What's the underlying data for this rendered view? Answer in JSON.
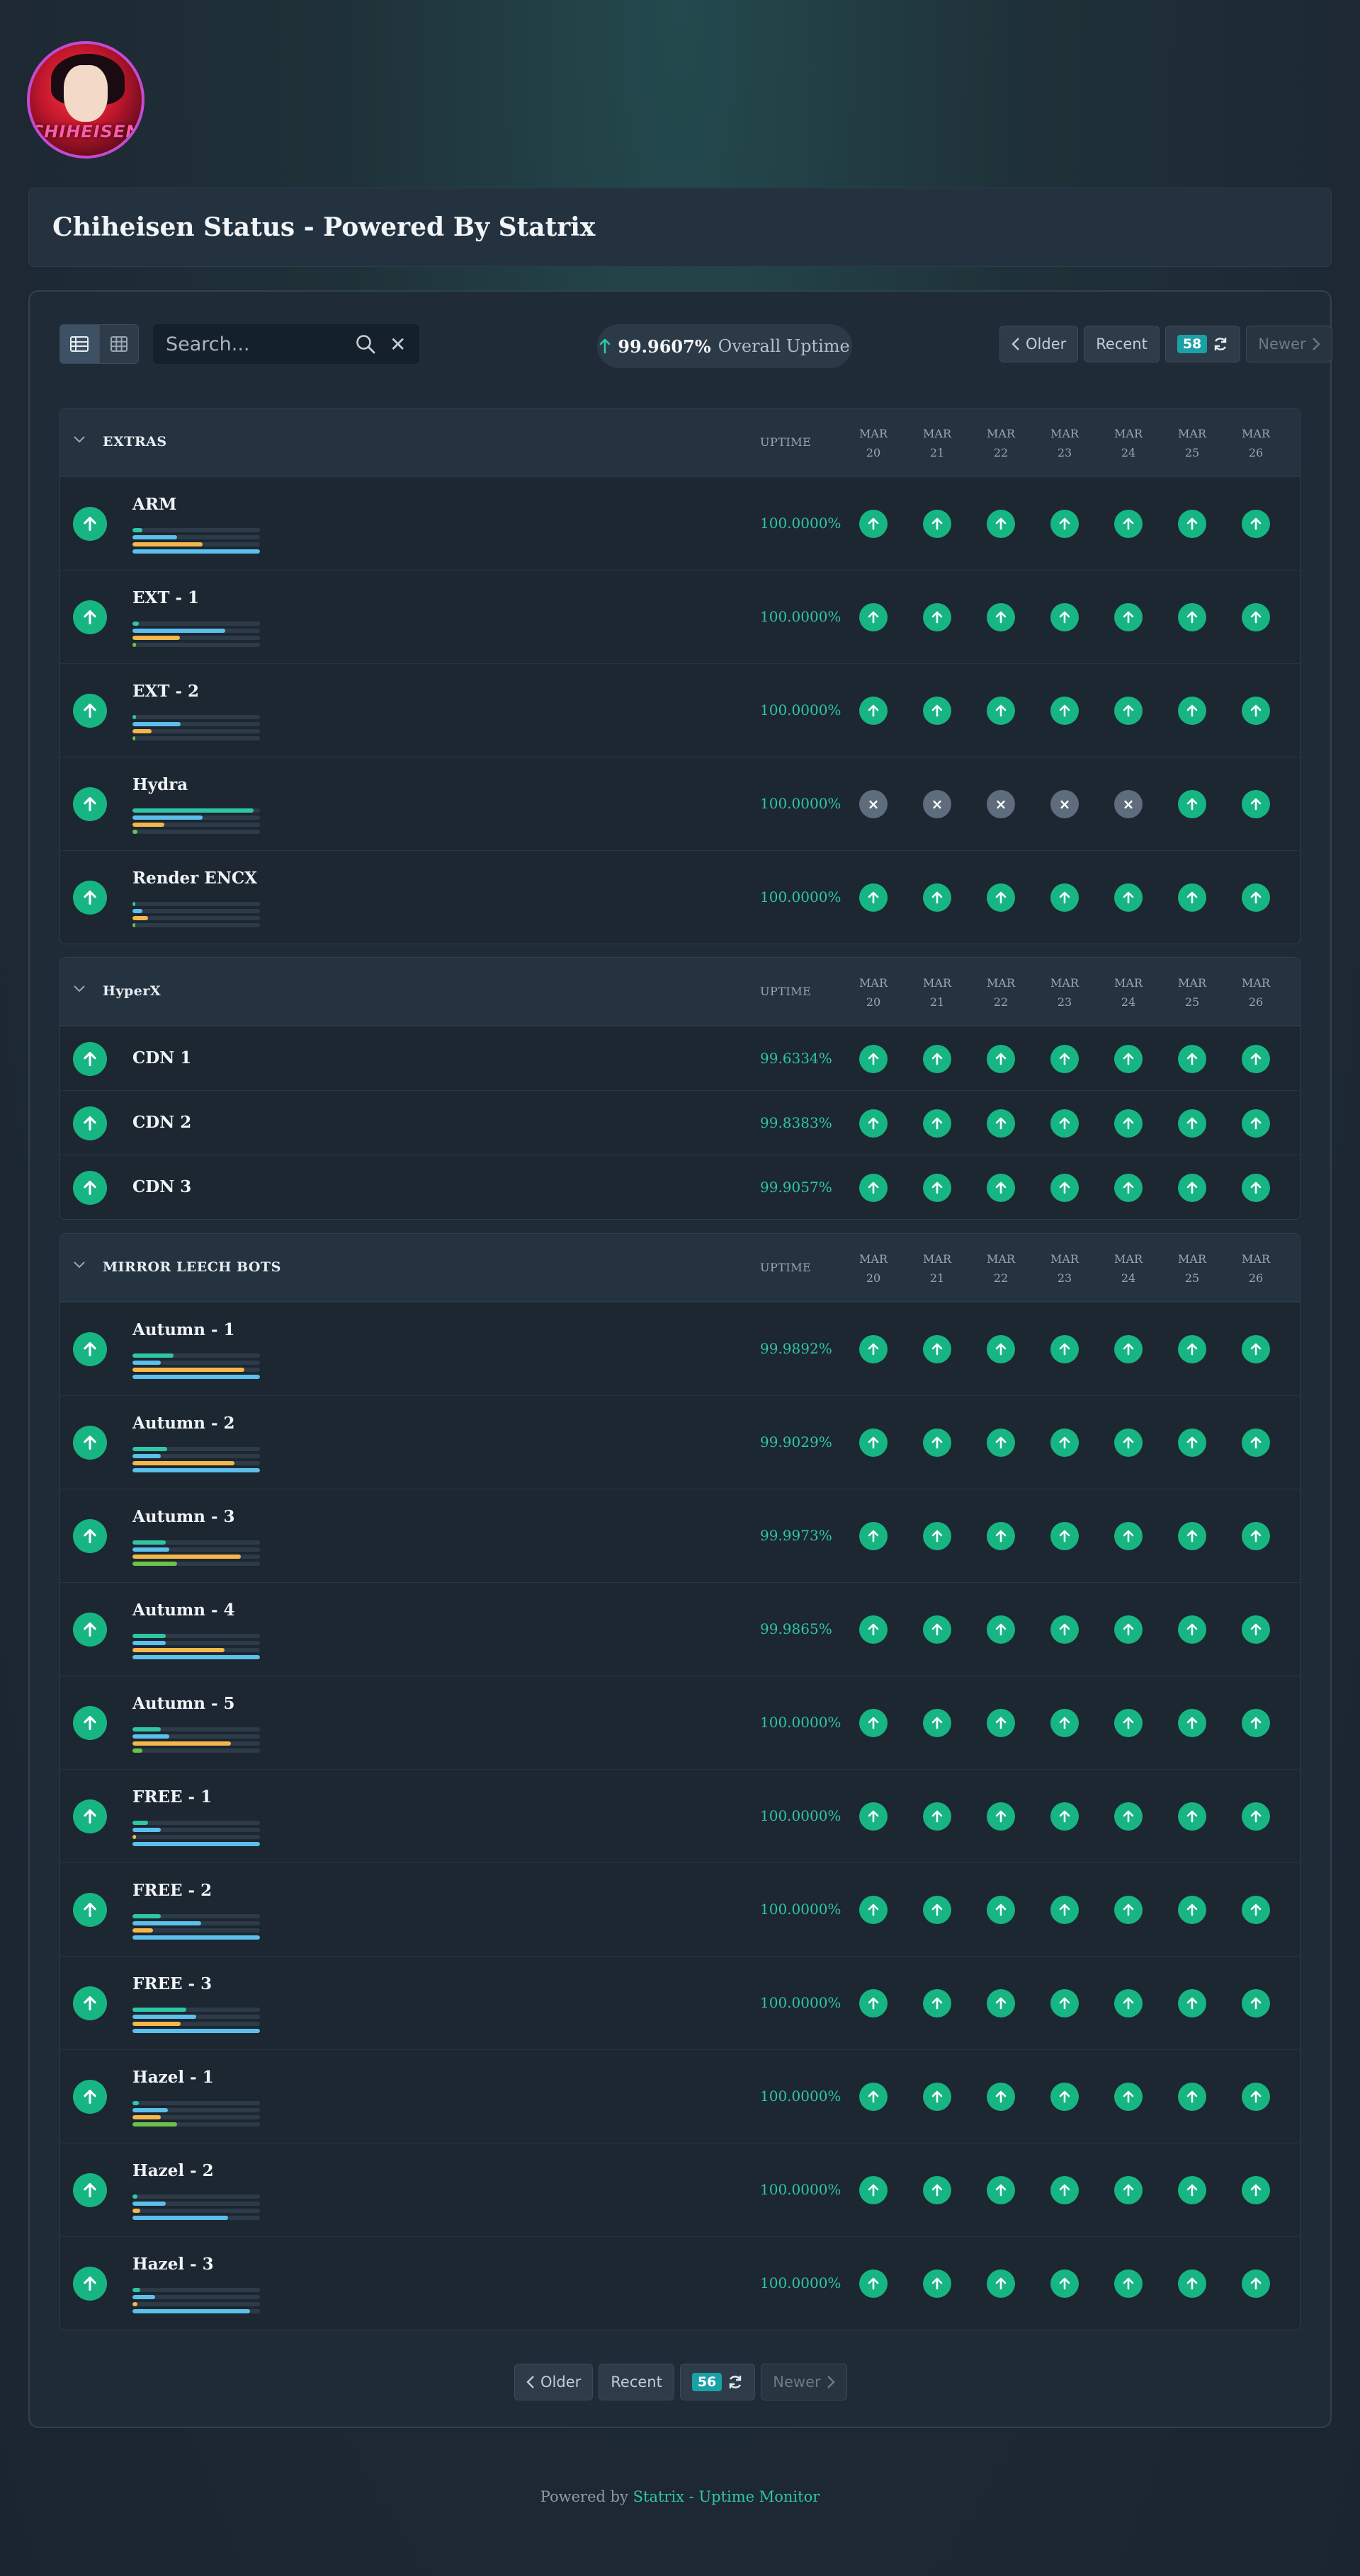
{
  "logo": {
    "text": "CHIHEISEN"
  },
  "page": {
    "title": "Chiheisen Status - Powered By Statrix"
  },
  "toolbar": {
    "search_placeholder": "Search...",
    "clear_symbol": "✕",
    "overall_uptime_value": "99.9607%",
    "overall_uptime_label": "Overall Uptime"
  },
  "pager_top": {
    "older": "Older",
    "recent": "Recent",
    "count": "58",
    "newer": "Newer"
  },
  "pager_bottom": {
    "older": "Older",
    "recent": "Recent",
    "count": "56",
    "newer": "Newer"
  },
  "days": [
    {
      "month": "MAR",
      "day": "20"
    },
    {
      "month": "MAR",
      "day": "21"
    },
    {
      "month": "MAR",
      "day": "22"
    },
    {
      "month": "MAR",
      "day": "23"
    },
    {
      "month": "MAR",
      "day": "24"
    },
    {
      "month": "MAR",
      "day": "25"
    },
    {
      "month": "MAR",
      "day": "26"
    }
  ],
  "uptime_header": "UPTIME",
  "colors": {
    "status_up": "#17b582",
    "status_unknown": "#5f6c7d",
    "uptime_text": "#2fc6a6",
    "bar_teal": "#2fc6a6",
    "bar_blue": "#5bc0eb",
    "bar_orange": "#f5b74a",
    "bar_green": "#6cc24a"
  },
  "groups": [
    {
      "name": "EXTRAS",
      "rows": [
        {
          "name": "ARM",
          "uptime": "100.0000%",
          "days": [
            "up",
            "up",
            "up",
            "up",
            "up",
            "up",
            "up"
          ],
          "bars": [
            0.08,
            0.35,
            0.55,
            1.0
          ]
        },
        {
          "name": "EXT - 1",
          "uptime": "100.0000%",
          "days": [
            "up",
            "up",
            "up",
            "up",
            "up",
            "up",
            "up"
          ],
          "bars": [
            0.05,
            0.73,
            0.37,
            0.03
          ]
        },
        {
          "name": "EXT - 2",
          "uptime": "100.0000%",
          "days": [
            "up",
            "up",
            "up",
            "up",
            "up",
            "up",
            "up"
          ],
          "bars": [
            0.03,
            0.38,
            0.15,
            0.02
          ]
        },
        {
          "name": "Hydra",
          "uptime": "100.0000%",
          "days": [
            "down",
            "down",
            "down",
            "down",
            "down",
            "up",
            "up"
          ],
          "bars": [
            0.95,
            0.55,
            0.25,
            0.04
          ]
        },
        {
          "name": "Render ENCX",
          "uptime": "100.0000%",
          "days": [
            "up",
            "up",
            "up",
            "up",
            "up",
            "up",
            "up"
          ],
          "bars": [
            0.02,
            0.08,
            0.12,
            0.02
          ]
        }
      ]
    },
    {
      "name": "HyperX",
      "rows": [
        {
          "name": "CDN 1",
          "uptime": "99.6334%",
          "days": [
            "up",
            "up",
            "up",
            "up",
            "up",
            "up",
            "up"
          ]
        },
        {
          "name": "CDN 2",
          "uptime": "99.8383%",
          "days": [
            "up",
            "up",
            "up",
            "up",
            "up",
            "up",
            "up"
          ]
        },
        {
          "name": "CDN 3",
          "uptime": "99.9057%",
          "days": [
            "up",
            "up",
            "up",
            "up",
            "up",
            "up",
            "up"
          ]
        }
      ]
    },
    {
      "name": "MIRROR LEECH BOTS",
      "rows": [
        {
          "name": "Autumn - 1",
          "uptime": "99.9892%",
          "days": [
            "up",
            "up",
            "up",
            "up",
            "up",
            "up",
            "up"
          ],
          "bars": [
            0.32,
            0.22,
            0.88,
            1.0
          ]
        },
        {
          "name": "Autumn - 2",
          "uptime": "99.9029%",
          "days": [
            "up",
            "up",
            "up",
            "up",
            "up",
            "up",
            "up"
          ],
          "bars": [
            0.27,
            0.22,
            0.8,
            1.0
          ]
        },
        {
          "name": "Autumn - 3",
          "uptime": "99.9973%",
          "days": [
            "up",
            "up",
            "up",
            "up",
            "up",
            "up",
            "up"
          ],
          "bars": [
            0.26,
            0.29,
            0.85,
            0.35
          ]
        },
        {
          "name": "Autumn - 4",
          "uptime": "99.9865%",
          "days": [
            "up",
            "up",
            "up",
            "up",
            "up",
            "up",
            "up"
          ],
          "bars": [
            0.26,
            0.26,
            0.72,
            1.0
          ]
        },
        {
          "name": "Autumn - 5",
          "uptime": "100.0000%",
          "days": [
            "up",
            "up",
            "up",
            "up",
            "up",
            "up",
            "up"
          ],
          "bars": [
            0.22,
            0.29,
            0.77,
            0.08
          ]
        },
        {
          "name": "FREE - 1",
          "uptime": "100.0000%",
          "days": [
            "up",
            "up",
            "up",
            "up",
            "up",
            "up",
            "up"
          ],
          "bars": [
            0.12,
            0.22,
            0.03,
            1.0
          ]
        },
        {
          "name": "FREE - 2",
          "uptime": "100.0000%",
          "days": [
            "up",
            "up",
            "up",
            "up",
            "up",
            "up",
            "up"
          ],
          "bars": [
            0.22,
            0.54,
            0.16,
            1.0
          ]
        },
        {
          "name": "FREE - 3",
          "uptime": "100.0000%",
          "days": [
            "up",
            "up",
            "up",
            "up",
            "up",
            "up",
            "up"
          ],
          "bars": [
            0.42,
            0.5,
            0.38,
            1.0
          ]
        },
        {
          "name": "Hazel - 1",
          "uptime": "100.0000%",
          "days": [
            "up",
            "up",
            "up",
            "up",
            "up",
            "up",
            "up"
          ],
          "bars": [
            0.05,
            0.28,
            0.22,
            0.35
          ]
        },
        {
          "name": "Hazel - 2",
          "uptime": "100.0000%",
          "days": [
            "up",
            "up",
            "up",
            "up",
            "up",
            "up",
            "up"
          ],
          "bars": [
            0.04,
            0.26,
            0.06,
            0.75
          ]
        },
        {
          "name": "Hazel - 3",
          "uptime": "100.0000%",
          "days": [
            "up",
            "up",
            "up",
            "up",
            "up",
            "up",
            "up"
          ],
          "bars": [
            0.06,
            0.18,
            0.04,
            0.92
          ]
        }
      ]
    }
  ],
  "footer": {
    "prefix": "Powered by",
    "link": "Statrix - Uptime Monitor"
  }
}
